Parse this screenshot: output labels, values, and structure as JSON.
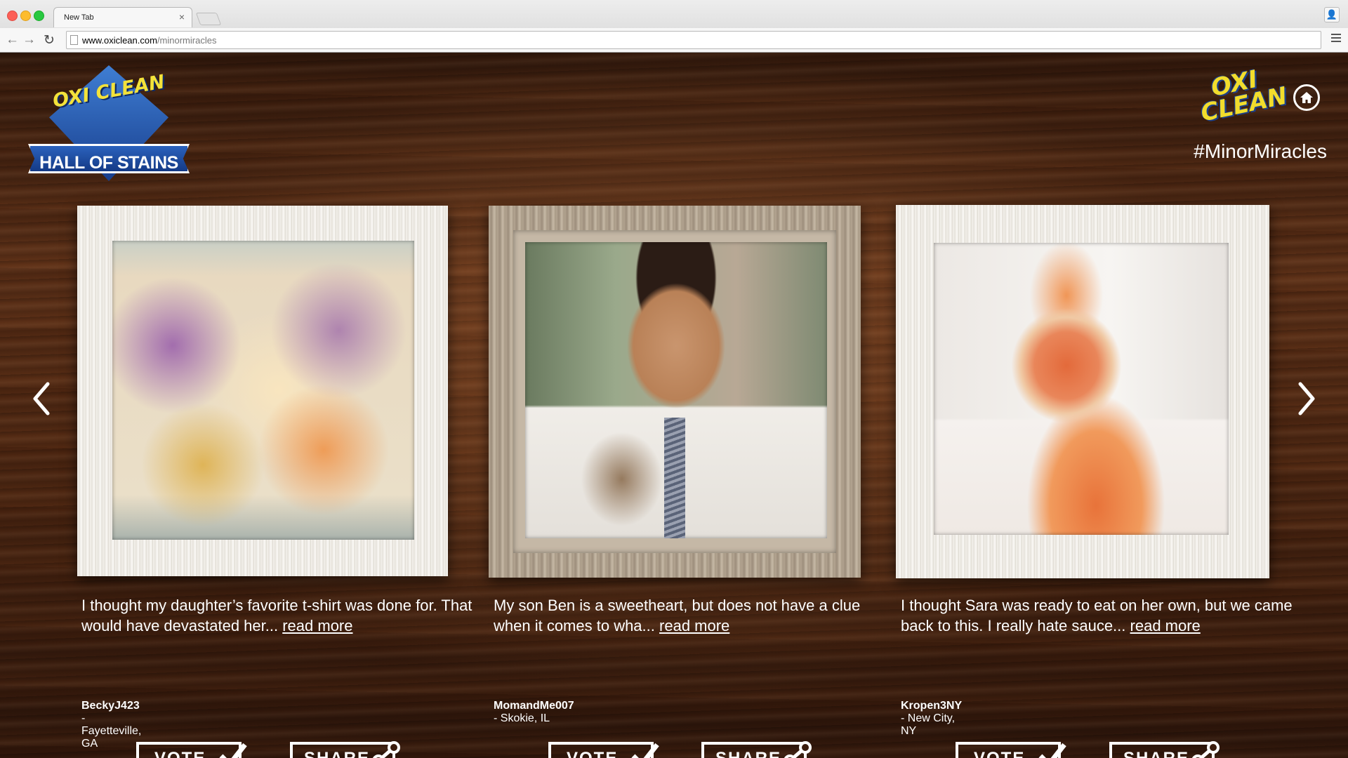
{
  "browser": {
    "tab_title": "New Tab",
    "tab_close": "×",
    "url_host": "www.oxiclean.com",
    "url_path": "/minormiracles",
    "back_icon": "←",
    "forward_icon": "→",
    "reload_icon": "↻"
  },
  "header": {
    "badge_brand": "OXI CLEAN",
    "badge_title": "HALL OF STAINS",
    "logo_text": "OXI CLEAN",
    "hashtag": "#MinorMiracles"
  },
  "entries": [
    {
      "caption": "I thought my daughter’s favorite t-shirt was done for. That would have devastated her...",
      "read_more": "read more",
      "user": "BeckyJ423",
      "location": "- Fayetteville, GA",
      "vote_label": "VOTE",
      "share_label": "SHARE"
    },
    {
      "caption": "My son Ben is a sweetheart, but does not have a clue when it comes to wha...",
      "read_more": "read more",
      "user": "MomandMe007",
      "location": "- Skokie, IL",
      "vote_label": "VOTE",
      "share_label": "SHARE"
    },
    {
      "caption": "I thought Sara was ready to eat on her own, but we came back to this. I really hate sauce...",
      "read_more": "read more",
      "user": "Kropen3NY",
      "location": "- New City, NY",
      "vote_label": "VOTE",
      "share_label": "SHARE"
    }
  ],
  "colors": {
    "wood_dark": "#2a140a",
    "wood_mid": "#5a2f17",
    "brand_blue": "#1b3f8a",
    "brand_yellow": "#f2dd2c"
  },
  "icons": [
    "back-icon",
    "forward-icon",
    "reload-icon",
    "page-icon",
    "menu-icon",
    "profile-icon",
    "home-icon",
    "chevron-left-icon",
    "chevron-right-icon",
    "checkmark-icon",
    "share-icon"
  ]
}
